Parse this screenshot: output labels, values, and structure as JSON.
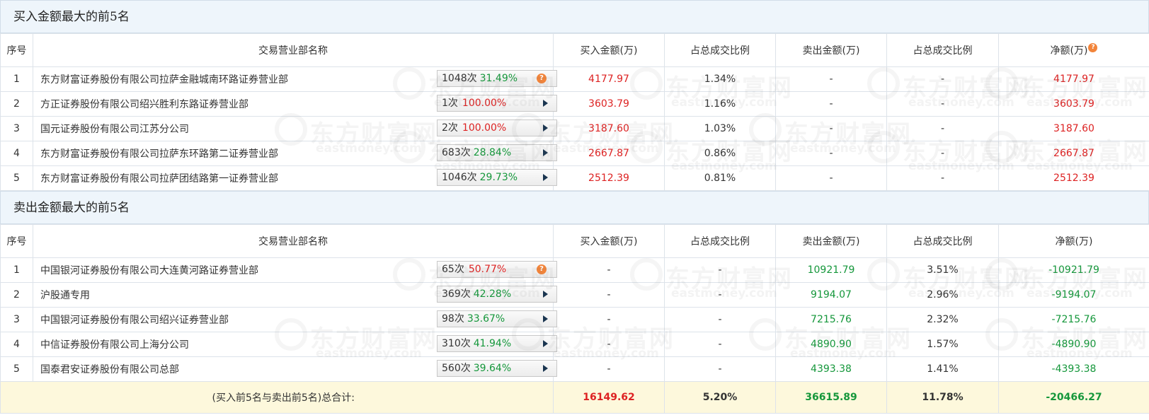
{
  "buy_section": {
    "title": "买入金额最大的前5名",
    "headers": [
      "序号",
      "交易营业部名称",
      "买入金额(万)",
      "占总成交比例",
      "卖出金额(万)",
      "占总成交比例",
      "净额(万)"
    ],
    "rows": [
      {
        "idx": "1",
        "name": "东方财富证券股份有限公司拉萨金融城南环路证券营业部",
        "count": "1048次",
        "pct": "31.49%",
        "icon": "question-icon",
        "buy": "4177.97",
        "buy_ratio": "1.34%",
        "sell": "-",
        "sell_ratio": "-",
        "net": "4177.97"
      },
      {
        "idx": "2",
        "name": "方正证券股份有限公司绍兴胜利东路证券营业部",
        "count": "1次",
        "pct": "100.00%",
        "icon": "play-arrow-icon",
        "buy": "3603.79",
        "buy_ratio": "1.16%",
        "sell": "-",
        "sell_ratio": "-",
        "net": "3603.79"
      },
      {
        "idx": "3",
        "name": "国元证券股份有限公司江苏分公司",
        "count": "2次",
        "pct": "100.00%",
        "icon": "play-arrow-icon",
        "buy": "3187.60",
        "buy_ratio": "1.03%",
        "sell": "-",
        "sell_ratio": "-",
        "net": "3187.60"
      },
      {
        "idx": "4",
        "name": "东方财富证券股份有限公司拉萨东环路第二证券营业部",
        "count": "683次",
        "pct": "28.84%",
        "icon": "play-arrow-icon",
        "buy": "2667.87",
        "buy_ratio": "0.86%",
        "sell": "-",
        "sell_ratio": "-",
        "net": "2667.87"
      },
      {
        "idx": "5",
        "name": "东方财富证券股份有限公司拉萨团结路第一证券营业部",
        "count": "1046次",
        "pct": "29.73%",
        "icon": "play-arrow-icon",
        "buy": "2512.39",
        "buy_ratio": "0.81%",
        "sell": "-",
        "sell_ratio": "-",
        "net": "2512.39"
      }
    ]
  },
  "sell_section": {
    "title": "卖出金额最大的前5名",
    "headers": [
      "序号",
      "交易营业部名称",
      "买入金额(万)",
      "占总成交比例",
      "卖出金额(万)",
      "占总成交比例",
      "净额(万)"
    ],
    "rows": [
      {
        "idx": "1",
        "name": "中国银河证券股份有限公司大连黄河路证券营业部",
        "count": "65次",
        "pct": "50.77%",
        "icon": "question-icon",
        "buy": "-",
        "buy_ratio": "-",
        "sell": "10921.79",
        "sell_ratio": "3.51%",
        "net": "-10921.79"
      },
      {
        "idx": "2",
        "name": "沪股通专用",
        "count": "369次",
        "pct": "42.28%",
        "icon": "play-arrow-icon",
        "buy": "-",
        "buy_ratio": "-",
        "sell": "9194.07",
        "sell_ratio": "2.96%",
        "net": "-9194.07"
      },
      {
        "idx": "3",
        "name": "中国银河证券股份有限公司绍兴证券营业部",
        "count": "98次",
        "pct": "33.67%",
        "icon": "play-arrow-icon",
        "buy": "-",
        "buy_ratio": "-",
        "sell": "7215.76",
        "sell_ratio": "2.32%",
        "net": "-7215.76"
      },
      {
        "idx": "4",
        "name": "中信证券股份有限公司上海分公司",
        "count": "310次",
        "pct": "41.94%",
        "icon": "play-arrow-icon",
        "buy": "-",
        "buy_ratio": "-",
        "sell": "4890.90",
        "sell_ratio": "1.57%",
        "net": "-4890.90"
      },
      {
        "idx": "5",
        "name": "国泰君安证券股份有限公司总部",
        "count": "560次",
        "pct": "39.64%",
        "icon": "play-arrow-icon",
        "buy": "-",
        "buy_ratio": "-",
        "sell": "4393.38",
        "sell_ratio": "1.41%",
        "net": "-4393.38"
      }
    ]
  },
  "total": {
    "label": "(买入前5名与卖出前5名)总合计:",
    "buy": "16149.62",
    "buy_ratio": "5.20%",
    "sell": "36615.89",
    "sell_ratio": "11.78%",
    "net": "-20466.27"
  },
  "watermark": {
    "cn": "东方财富网",
    "en": "eastmoney.com"
  },
  "colors": {
    "positive_red": "#dd2222",
    "negative_green": "#15973b",
    "header_bg": "#eef5fb",
    "total_bg": "#fdf8dc",
    "help_orange": "#f2843a"
  }
}
